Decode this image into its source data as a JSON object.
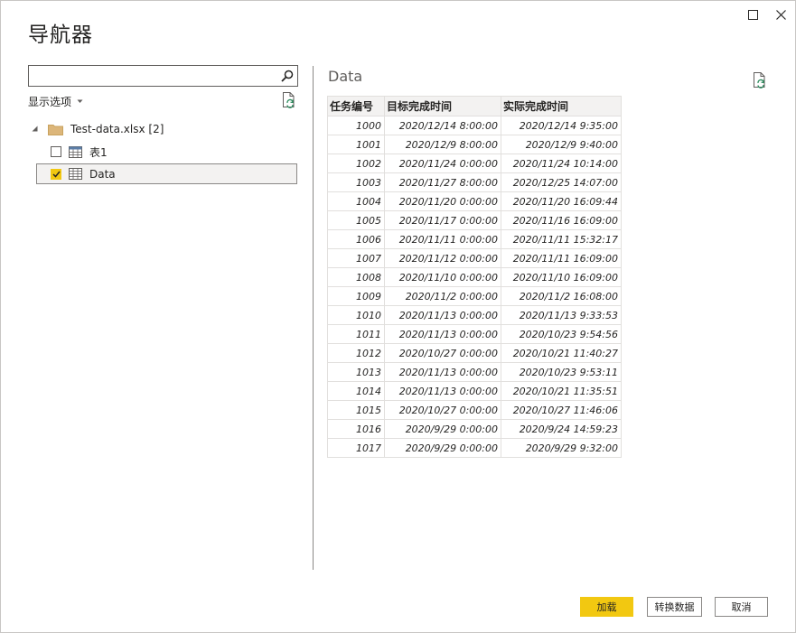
{
  "window": {
    "title": "导航器"
  },
  "search": {
    "placeholder": "",
    "value": ""
  },
  "left_panel": {
    "display_options_label": "显示选项",
    "tree": {
      "root_label": "Test-data.xlsx [2]",
      "items": [
        {
          "label": "表1",
          "checked": false,
          "selected": false
        },
        {
          "label": "Data",
          "checked": true,
          "selected": true
        }
      ]
    }
  },
  "preview": {
    "title": "Data",
    "columns": [
      "任务编号",
      "目标完成时间",
      "实际完成时间"
    ],
    "rows": [
      [
        "1000",
        "2020/12/14 8:00:00",
        "2020/12/14 9:35:00"
      ],
      [
        "1001",
        "2020/12/9 8:00:00",
        "2020/12/9 9:40:00"
      ],
      [
        "1002",
        "2020/11/24 0:00:00",
        "2020/11/24 10:14:00"
      ],
      [
        "1003",
        "2020/11/27 8:00:00",
        "2020/12/25 14:07:00"
      ],
      [
        "1004",
        "2020/11/20 0:00:00",
        "2020/11/20 16:09:44"
      ],
      [
        "1005",
        "2020/11/17 0:00:00",
        "2020/11/16 16:09:00"
      ],
      [
        "1006",
        "2020/11/11 0:00:00",
        "2020/11/11 15:32:17"
      ],
      [
        "1007",
        "2020/11/12 0:00:00",
        "2020/11/11 16:09:00"
      ],
      [
        "1008",
        "2020/11/10 0:00:00",
        "2020/11/10 16:09:00"
      ],
      [
        "1009",
        "2020/11/2 0:00:00",
        "2020/11/2 16:08:00"
      ],
      [
        "1010",
        "2020/11/13 0:00:00",
        "2020/11/13 9:33:53"
      ],
      [
        "1011",
        "2020/11/13 0:00:00",
        "2020/10/23 9:54:56"
      ],
      [
        "1012",
        "2020/10/27 0:00:00",
        "2020/10/21 11:40:27"
      ],
      [
        "1013",
        "2020/11/13 0:00:00",
        "2020/10/23 9:53:11"
      ],
      [
        "1014",
        "2020/11/13 0:00:00",
        "2020/10/21 11:35:51"
      ],
      [
        "1015",
        "2020/10/27 0:00:00",
        "2020/10/27 11:46:06"
      ],
      [
        "1016",
        "2020/9/29 0:00:00",
        "2020/9/24 14:59:23"
      ],
      [
        "1017",
        "2020/9/29 0:00:00",
        "2020/9/29 9:32:00"
      ]
    ]
  },
  "footer": {
    "load_label": "加载",
    "transform_label": "转换数据",
    "cancel_label": "取消"
  },
  "colors": {
    "accent": "#f2c811",
    "folder": "#dcb67a",
    "selected_bg": "#f3f2f1",
    "border": "#8a8886"
  },
  "icons": [
    "maximize-icon",
    "close-icon",
    "search-icon",
    "dropdown-caret-icon",
    "refresh-icon",
    "folder-icon",
    "table-icon",
    "checkmark-icon",
    "expand-triangle-icon"
  ]
}
